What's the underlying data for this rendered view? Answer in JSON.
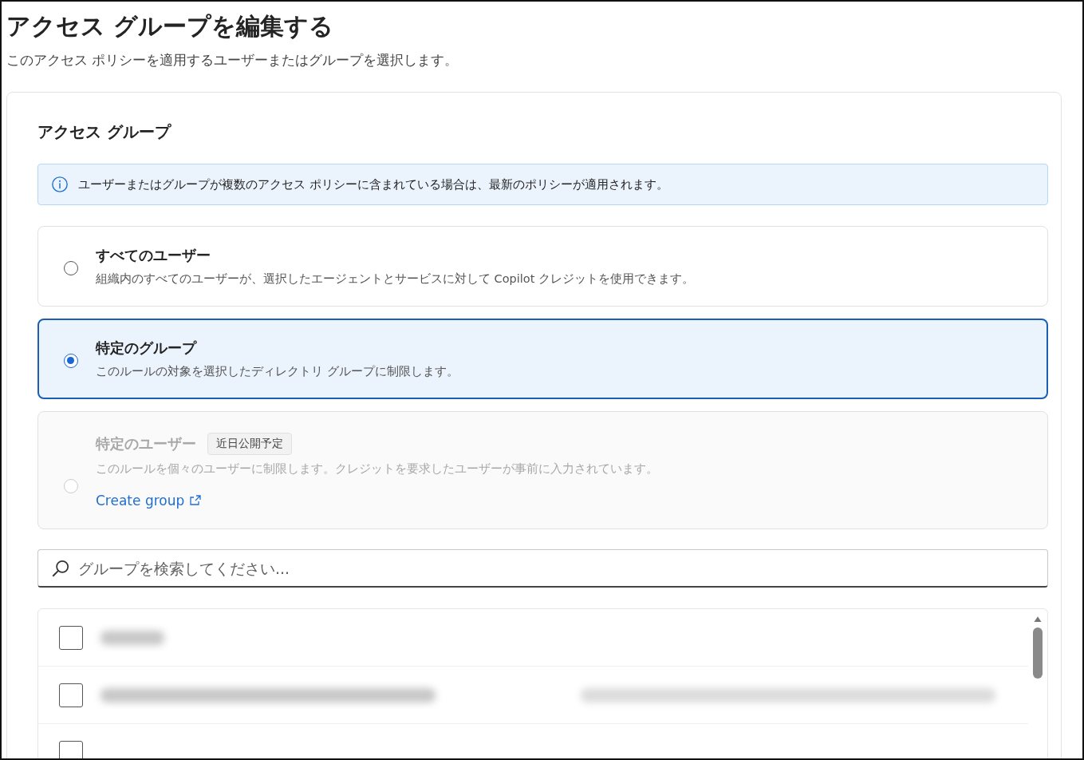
{
  "title": "アクセス グループを編集する",
  "subtitle": "このアクセス ポリシーを適用するユーザーまたはグループを選択します。",
  "section": {
    "heading": "アクセス グループ",
    "notice": "ユーザーまたはグループが複数のアクセス ポリシーに含まれている場合は、最新のポリシーが適用されます。",
    "options": [
      {
        "label": "すべてのユーザー",
        "description": "組織内のすべてのユーザーが、選択したエージェントとサービスに対して Copilot クレジットを使用できます。",
        "selected": false,
        "disabled": false
      },
      {
        "label": "特定のグループ",
        "description": "このルールの対象を選択したディレクトリ グループに制限します。",
        "selected": true,
        "disabled": false
      },
      {
        "label": "特定のユーザー",
        "badge": "近日公開予定",
        "description": "このルールを個々のユーザーに制限します。クレジットを要求したユーザーが事前に入力されています。",
        "link": "Create group",
        "selected": false,
        "disabled": true
      }
    ],
    "search": {
      "placeholder": "グループを検索してください..."
    },
    "group_list": {
      "rows": [
        {
          "checked": false,
          "cells": [
            {
              "kind": "redacted"
            }
          ]
        },
        {
          "checked": false,
          "cells": [
            {
              "kind": "redacted"
            },
            {
              "kind": "redacted"
            }
          ]
        },
        {
          "checked": false,
          "cells": []
        }
      ]
    }
  }
}
